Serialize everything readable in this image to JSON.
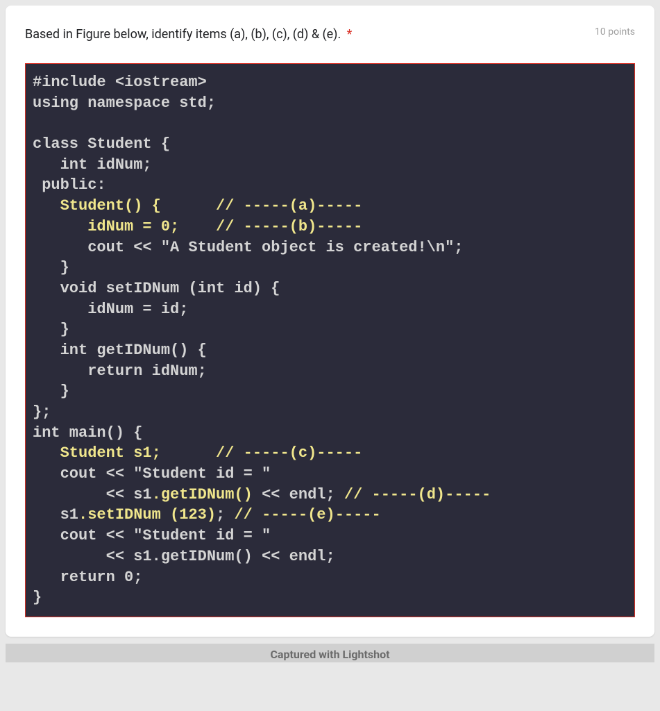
{
  "question": {
    "text": "Based in Figure below, identify items (a), (b), (c), (d) & (e).",
    "required_marker": "*",
    "points": "10 points"
  },
  "code": {
    "lines": [
      {
        "plain": "#include <iostream>"
      },
      {
        "plain": "using namespace std;"
      },
      {
        "plain": ""
      },
      {
        "plain": "class Student {"
      },
      {
        "plain": "   int idNum;"
      },
      {
        "plain": " public:"
      },
      {
        "indent": "   ",
        "yellow": "Student() {      // -----(a)-----"
      },
      {
        "indent": "      ",
        "yellow": "idNum = 0;    // -----(b)-----"
      },
      {
        "plain": "      cout << \"A Student object is created!\\n\";"
      },
      {
        "plain": "   }"
      },
      {
        "plain": "   void setIDNum (int id) {"
      },
      {
        "plain": "      idNum = id;"
      },
      {
        "plain": "   }"
      },
      {
        "plain": "   int getIDNum() {"
      },
      {
        "plain": "      return idNum;"
      },
      {
        "plain": "   }"
      },
      {
        "plain": "};"
      },
      {
        "plain": "int main() {"
      },
      {
        "indent": "   ",
        "yellow": "Student s1;      // -----(c)-----"
      },
      {
        "plain": "   cout << \"Student id = \""
      },
      {
        "mid_prefix": "        << s1",
        "mid_yellow": ".getIDNum()",
        "mid_suffix": " << endl; ",
        "trail_yellow": "// -----(d)-----"
      },
      {
        "mid_prefix": "   s1",
        "mid_yellow": ".setIDNum (123)",
        "mid_suffix": "; ",
        "trail_yellow": "// -----(e)-----"
      },
      {
        "plain": "   cout << \"Student id = \""
      },
      {
        "plain": "        << s1.getIDNum() << endl;"
      },
      {
        "plain": "   return 0;"
      },
      {
        "plain": "}"
      }
    ]
  },
  "footer": {
    "label": "Captured with Lightshot"
  }
}
